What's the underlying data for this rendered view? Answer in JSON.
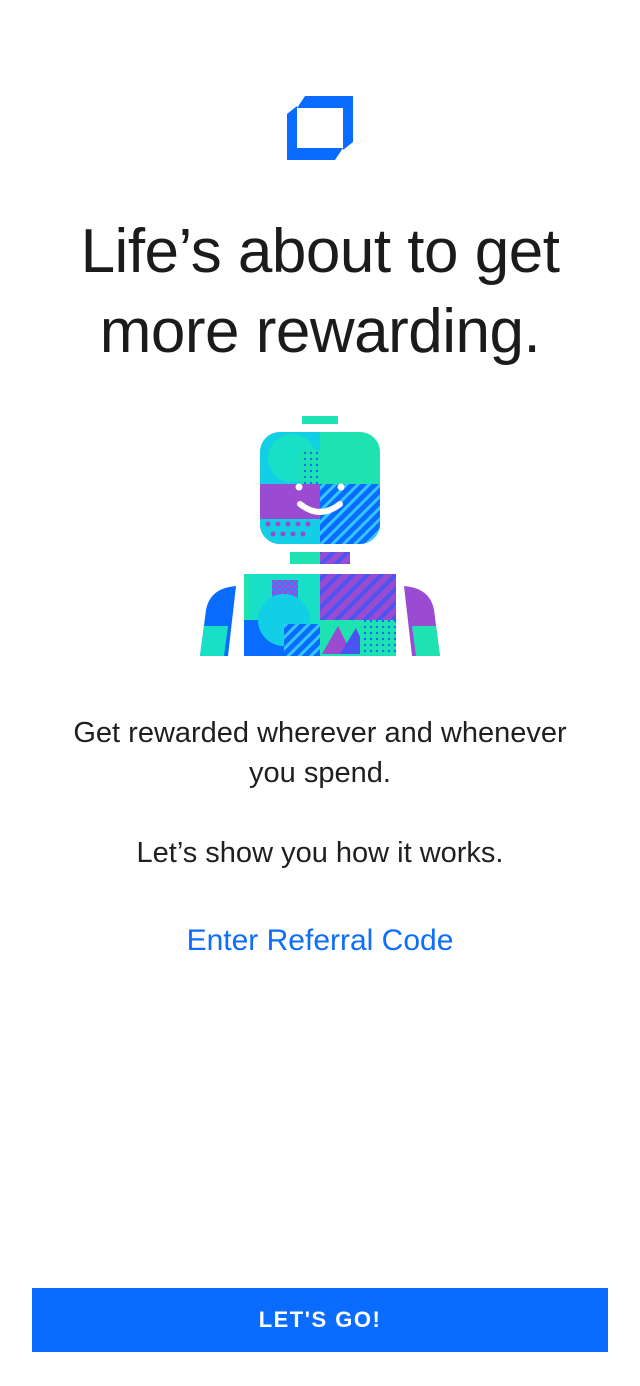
{
  "colors": {
    "brand_blue": "#0a6cff",
    "link_blue": "#0d6dfc",
    "mint": "#1ee3b0",
    "purple": "#9a4bd1",
    "cyan": "#12cfe6"
  },
  "onboarding": {
    "logo_icon": "brand-logo-icon",
    "headline_line1": "Life’s about to get",
    "headline_line2": "more rewarding.",
    "illustration_icon": "rewards-character-illustration",
    "body_line1": "Get rewarded wherever and whenever",
    "body_line2": "you spend.",
    "body_2": "Let’s show you how it works.",
    "referral_link": "Enter Referral Code",
    "cta_label": "LET'S GO!"
  }
}
